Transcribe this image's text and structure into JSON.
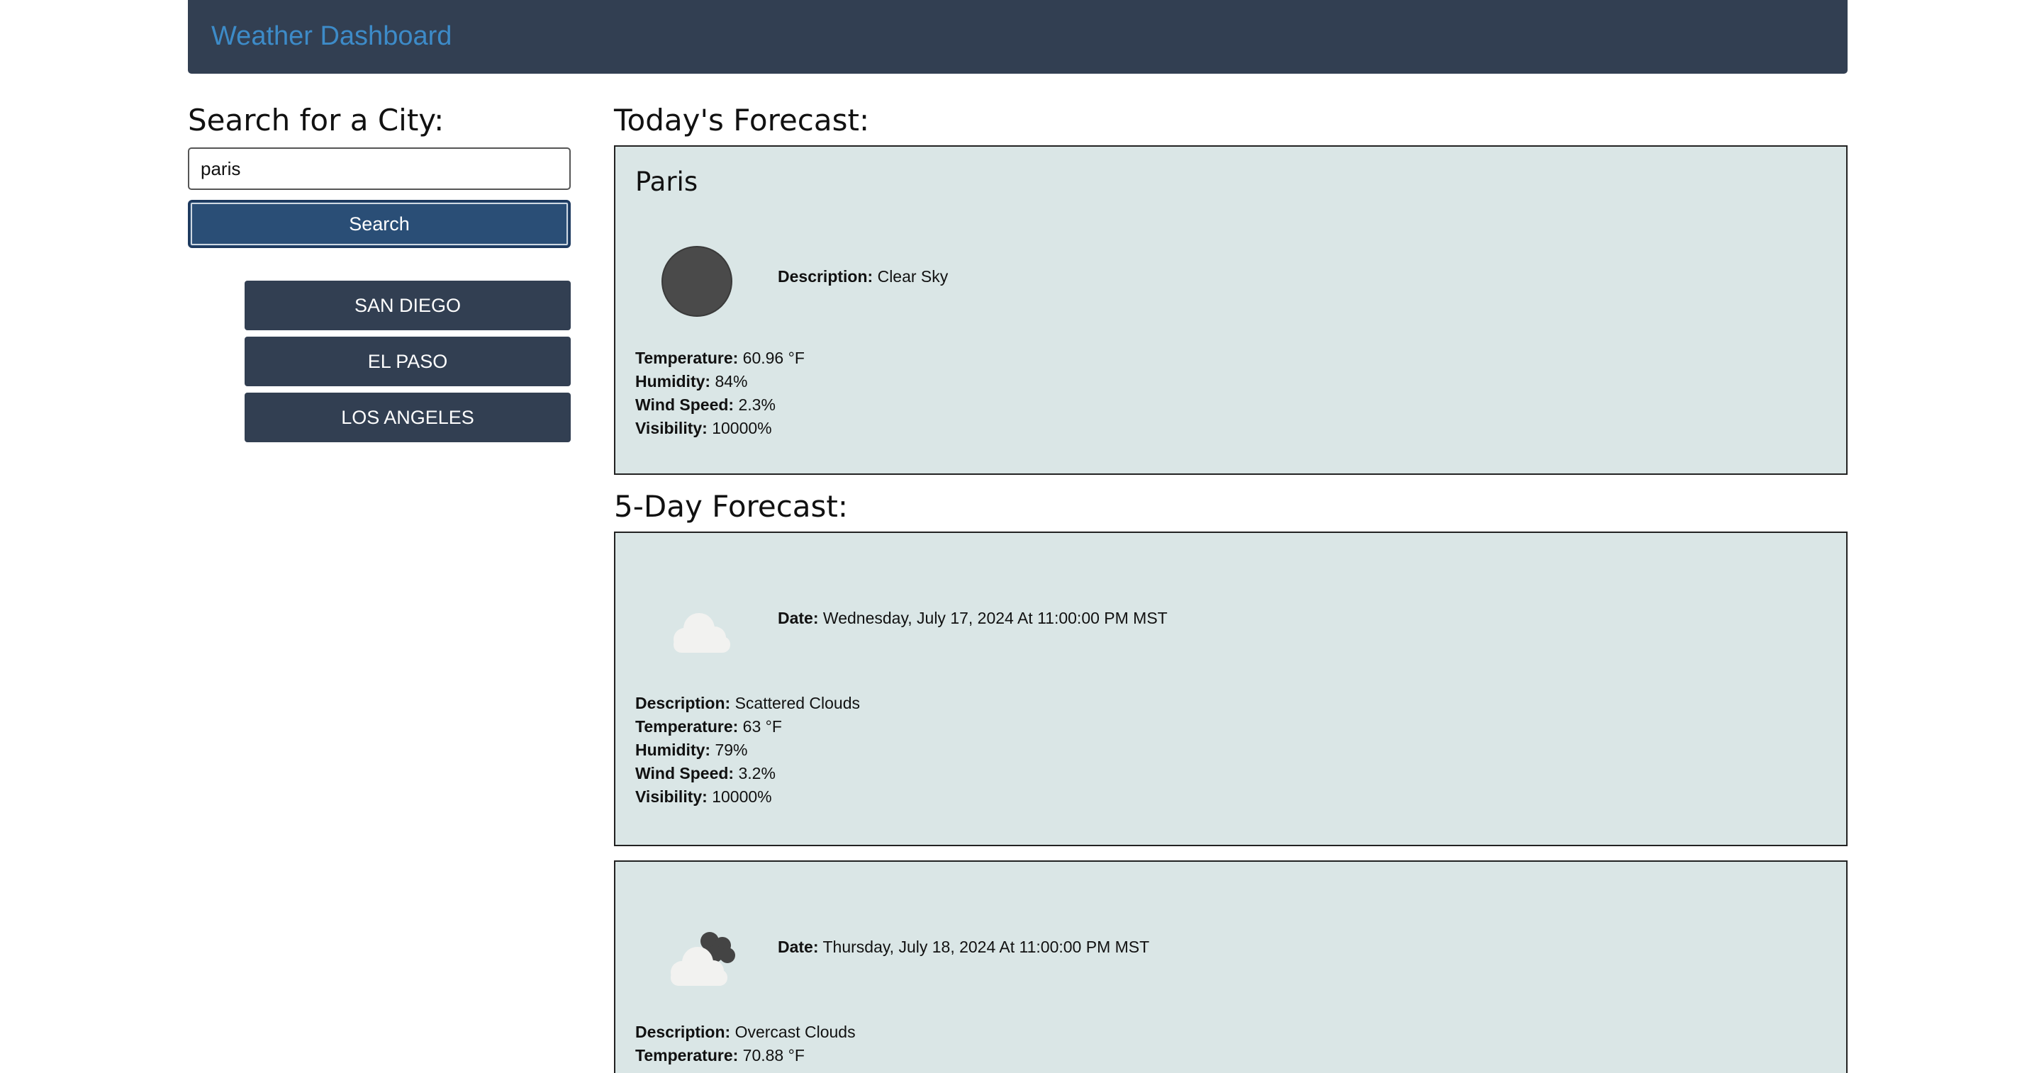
{
  "header": {
    "title": "Weather Dashboard"
  },
  "search": {
    "heading": "Search for a City:",
    "input_value": "paris",
    "button_label": "Search"
  },
  "history": [
    {
      "label": "SAN DIEGO"
    },
    {
      "label": "EL PASO"
    },
    {
      "label": "LOS ANGELES"
    }
  ],
  "today": {
    "heading": "Today's Forecast:",
    "city": "Paris",
    "icon": "clear-sky-icon",
    "description_label": "Description:",
    "description": "Clear Sky",
    "temperature_label": "Temperature:",
    "temperature": "60.96 °F",
    "humidity_label": "Humidity:",
    "humidity": "84%",
    "wind_label": "Wind Speed:",
    "wind": "2.3%",
    "visibility_label": "Visibility:",
    "visibility": "10000%"
  },
  "forecast": {
    "heading": "5-Day Forecast:",
    "days": [
      {
        "icon": "scattered-clouds-icon",
        "date_label": "Date:",
        "date": "Wednesday, July 17, 2024 At 11:00:00 PM MST",
        "description_label": "Description:",
        "description": "Scattered Clouds",
        "temperature_label": "Temperature:",
        "temperature": "63 °F",
        "humidity_label": "Humidity:",
        "humidity": "79%",
        "wind_label": "Wind Speed:",
        "wind": "3.2%",
        "visibility_label": "Visibility:",
        "visibility": "10000%"
      },
      {
        "icon": "overcast-clouds-icon",
        "date_label": "Date:",
        "date": "Thursday, July 18, 2024 At 11:00:00 PM MST",
        "description_label": "Description:",
        "description": "Overcast Clouds",
        "temperature_label": "Temperature:",
        "temperature": "70.88 °F"
      }
    ]
  },
  "colors": {
    "header_bg": "#323f52",
    "title": "#3d8bc8",
    "search_button": "#2a4e76",
    "card_bg": "#dae6e6"
  }
}
